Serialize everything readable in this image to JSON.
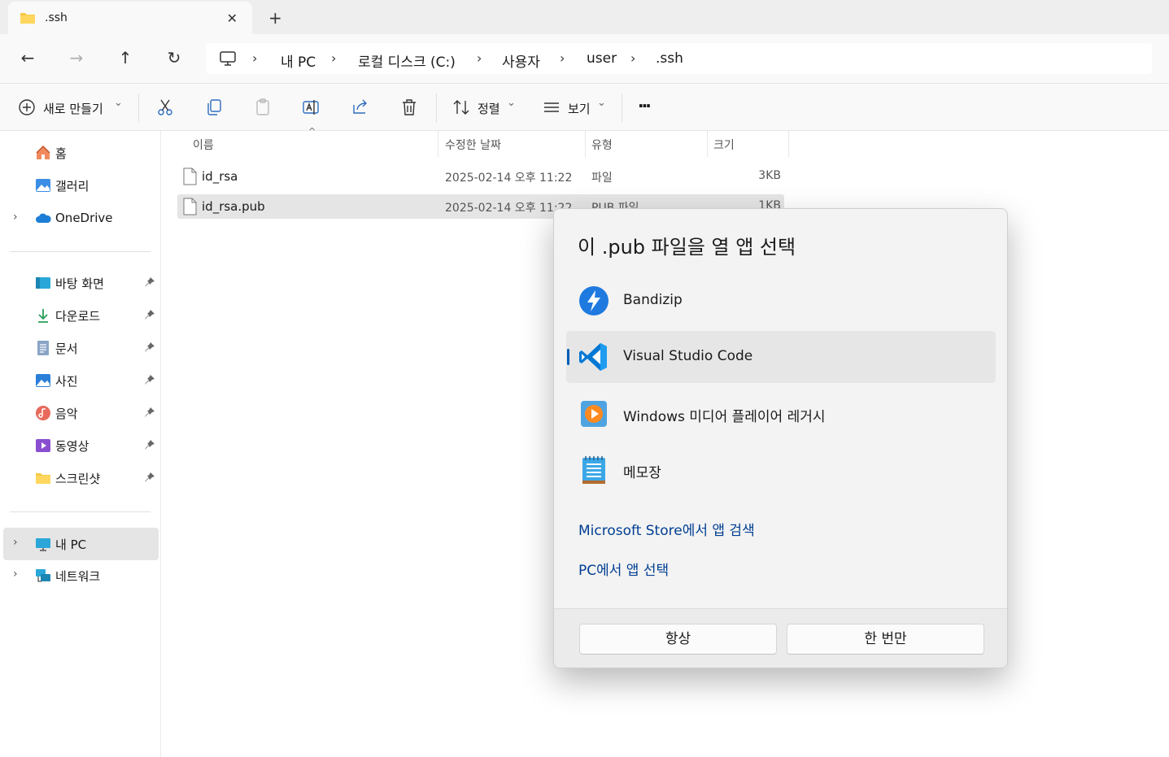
{
  "tab": {
    "title": ".ssh",
    "close_glyph": "✕",
    "new_glyph": "+"
  },
  "nav": {
    "back": "←",
    "forward": "→",
    "up": "↑",
    "refresh": "↻"
  },
  "breadcrumb": [
    "내 PC",
    "로컬 디스크 (C:)",
    "사용자",
    "user",
    ".ssh"
  ],
  "toolbar": {
    "new_label": "새로 만들기",
    "sort_label": "정렬",
    "view_label": "보기",
    "more_glyph": "···",
    "chevron": "⌄"
  },
  "sidebar": {
    "top": [
      {
        "label": "홈",
        "icon": "home-icon"
      },
      {
        "label": "갤러리",
        "icon": "gallery-icon"
      },
      {
        "label": "OneDrive",
        "icon": "onedrive-icon",
        "expandable": true
      }
    ],
    "pinned": [
      {
        "label": "바탕 화면",
        "icon": "desktop-icon"
      },
      {
        "label": "다운로드",
        "icon": "downloads-icon"
      },
      {
        "label": "문서",
        "icon": "documents-icon"
      },
      {
        "label": "사진",
        "icon": "pictures-icon"
      },
      {
        "label": "음악",
        "icon": "music-icon"
      },
      {
        "label": "동영상",
        "icon": "videos-icon"
      },
      {
        "label": "스크린샷",
        "icon": "folder-icon"
      }
    ],
    "bottom": [
      {
        "label": "내 PC",
        "icon": "pc-icon",
        "selected": true
      },
      {
        "label": "네트워크",
        "icon": "network-icon"
      }
    ],
    "chevron": "›"
  },
  "columns": {
    "name": "이름",
    "date": "수정한 날짜",
    "type": "유형",
    "size": "크기"
  },
  "files": [
    {
      "name": "id_rsa",
      "date": "2025-02-14 오후 11:22",
      "type": "파일",
      "size": "3KB"
    },
    {
      "name": "id_rsa.pub",
      "date": "2025-02-14 오후 11:22",
      "type": "PUB 파일",
      "size": "1KB",
      "selected": true
    }
  ],
  "dialog": {
    "title": "이 .pub 파일을 열 앱 선택",
    "apps": [
      {
        "label": "Bandizip",
        "icon": "bandizip-icon"
      },
      {
        "label": "Visual Studio Code",
        "icon": "vscode-icon",
        "selected": true
      },
      {
        "label": "Windows 미디어 플레이어 레거시",
        "icon": "media-player-icon"
      },
      {
        "label": "메모장",
        "icon": "notepad-icon"
      }
    ],
    "store_link": "Microsoft Store에서 앱 검색",
    "pc_link": "PC에서 앱 선택",
    "always_button": "항상",
    "once_button": "한 번만"
  },
  "colors": {
    "accent": "#005fb8",
    "link": "#003e92",
    "selection": "#e5e5e5"
  }
}
